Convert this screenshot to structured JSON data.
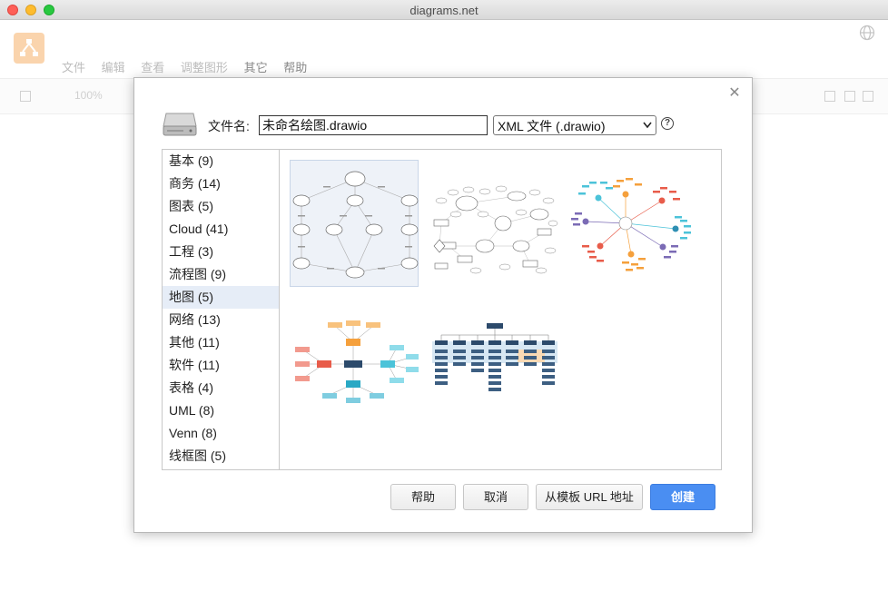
{
  "window": {
    "title": "diagrams.net"
  },
  "app": {
    "menu": [
      "文件",
      "编辑",
      "查看",
      "调整图形",
      "其它",
      "帮助"
    ],
    "toolbar": {
      "zoom": "100%"
    }
  },
  "dialog": {
    "filename_label": "文件名:",
    "filename_value": "未命名绘图.drawio",
    "format_selected": "XML 文件 (.drawio)",
    "categories": [
      {
        "label": "基本 (9)"
      },
      {
        "label": "商务 (14)"
      },
      {
        "label": "图表 (5)"
      },
      {
        "label": "Cloud (41)"
      },
      {
        "label": "工程 (3)"
      },
      {
        "label": "流程图 (9)"
      },
      {
        "label": "地图 (5)",
        "selected": true
      },
      {
        "label": "网络 (13)"
      },
      {
        "label": "其他 (11)"
      },
      {
        "label": "软件 (11)"
      },
      {
        "label": "表格 (4)"
      },
      {
        "label": "UML (8)"
      },
      {
        "label": "Venn (8)"
      },
      {
        "label": "线框图 (5)"
      }
    ],
    "templates": [
      {
        "name": "map-template-1",
        "selected": true
      },
      {
        "name": "map-template-2"
      },
      {
        "name": "map-template-3"
      },
      {
        "name": "map-template-4"
      },
      {
        "name": "map-template-5"
      }
    ],
    "buttons": {
      "help": "帮助",
      "cancel": "取消",
      "from_url": "从模板 URL 地址",
      "create": "创建"
    }
  },
  "colors": {
    "accent": "#4a8ef2",
    "selection": "#e6edf7",
    "mindmap_orange": "#f5a03c",
    "mindmap_teal": "#4cc3d9",
    "mindmap_red": "#e85c4a",
    "mindmap_purple": "#7b6bb5",
    "org_navy": "#2c4a6b"
  }
}
